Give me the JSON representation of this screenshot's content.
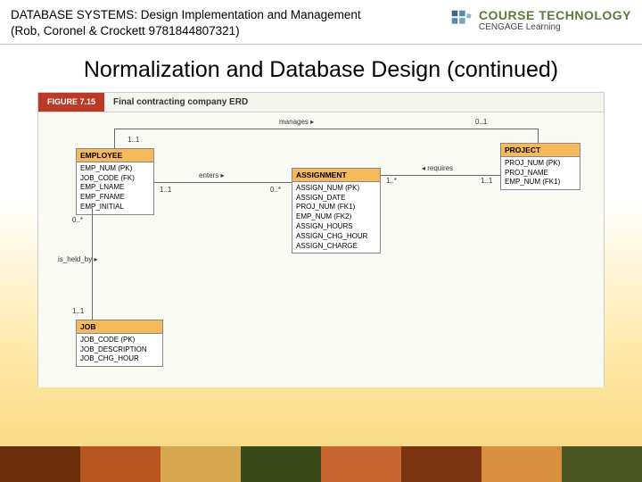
{
  "header": {
    "book": "DATABASE SYSTEMS: Design Implementation and Management (Rob, Coronel & Crockett 9781844807321)",
    "brand_main": "COURSE TECHNOLOGY",
    "brand_sub": "CENGAGE Learning"
  },
  "title": "Normalization and Database Design (continued)",
  "figure": {
    "number": "FIGURE 7.15",
    "caption": "Final contracting company ERD"
  },
  "entities": {
    "employee": {
      "name": "EMPLOYEE",
      "attrs": [
        "EMP_NUM (PK)",
        "JOB_CODE (FK)",
        "EMP_LNAME",
        "EMP_FNAME",
        "EMP_INITIAL"
      ]
    },
    "assignment": {
      "name": "ASSIGNMENT",
      "attrs": [
        "ASSIGN_NUM (PK)",
        "ASSIGN_DATE",
        "PROJ_NUM (FK1)",
        "EMP_NUM (FK2)",
        "ASSIGN_HOURS",
        "ASSIGN_CHG_HOUR",
        "ASSIGN_CHARGE"
      ]
    },
    "project": {
      "name": "PROJECT",
      "attrs": [
        "PROJ_NUM (PK)",
        "PROJ_NAME",
        "EMP_NUM (FK1)"
      ]
    },
    "job": {
      "name": "JOB",
      "attrs": [
        "JOB_CODE (PK)",
        "JOB_DESCRIPTION",
        "JOB_CHG_HOUR"
      ]
    }
  },
  "relationships": {
    "manages": "manages ▸",
    "enters": "enters ▸",
    "requires": "◂ requires",
    "is_held_by": "is_held_by ▸"
  },
  "cardinalities": {
    "emp_mgr": "1..1",
    "proj_mgr": "0..1",
    "emp_assign": "1..1",
    "assign_emp": "0..*",
    "proj_assign": "1..1",
    "assign_proj": "1..*",
    "emp_job": "0..*",
    "job_emp": "1..1"
  }
}
